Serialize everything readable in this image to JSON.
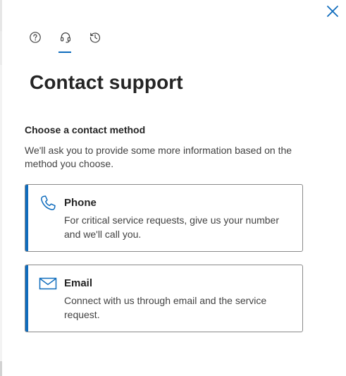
{
  "tabs": [
    {
      "name": "help",
      "icon": "question-circle-icon",
      "selected": false
    },
    {
      "name": "contact",
      "icon": "headset-icon",
      "selected": true
    },
    {
      "name": "history",
      "icon": "history-icon",
      "selected": false
    }
  ],
  "close_icon": "close-icon",
  "title": "Contact support",
  "subhead": "Choose a contact method",
  "description": "We'll ask you to provide some more information based on the method you choose.",
  "methods": [
    {
      "icon": "phone-icon",
      "title": "Phone",
      "description": "For critical service requests, give us your number and we'll call you."
    },
    {
      "icon": "mail-icon",
      "title": "Email",
      "description": "Connect with us through email and the service request."
    }
  ],
  "colors": {
    "accent": "#0f6cbd",
    "text": "#242424",
    "muted": "#424242"
  }
}
